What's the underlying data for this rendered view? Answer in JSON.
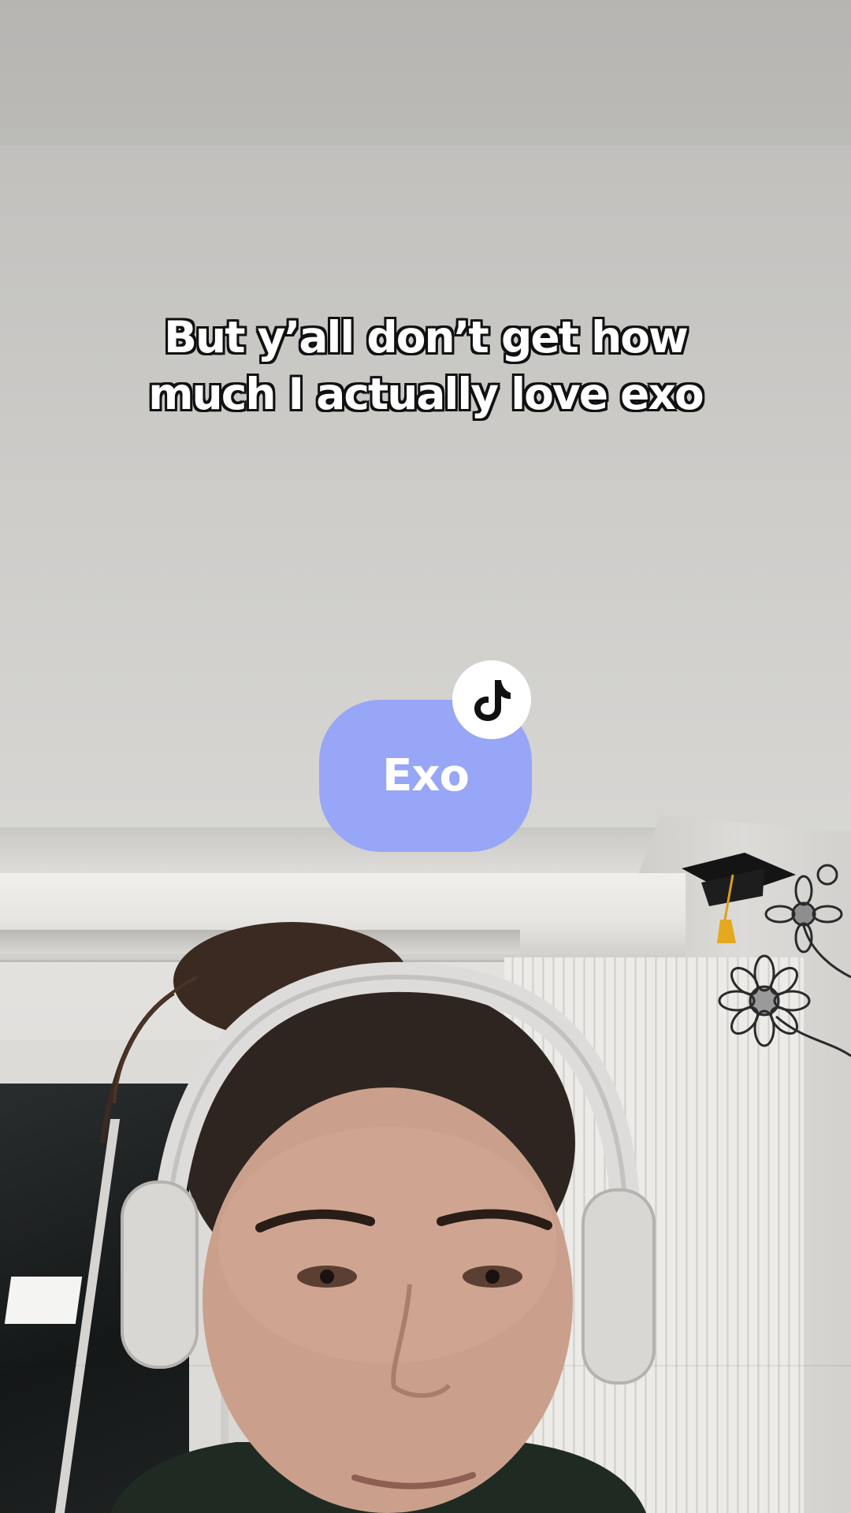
{
  "overlay": {
    "caption_lines": [
      "But y’all don’t get how",
      "much I actually love exo"
    ],
    "sticker": {
      "label": "Exo",
      "color": "#97a6f6",
      "badge_icon": "tiktok-note-icon"
    }
  }
}
